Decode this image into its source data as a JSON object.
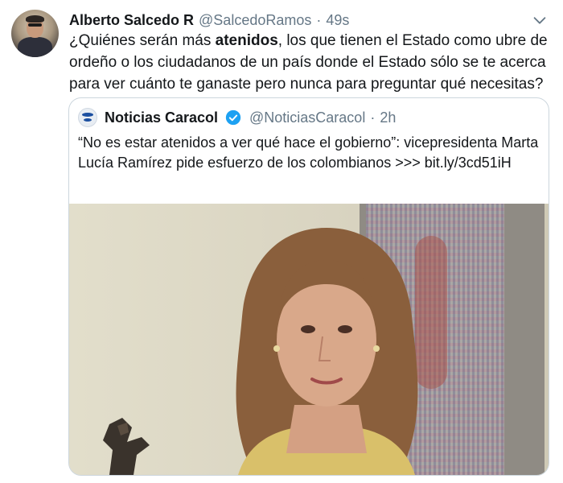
{
  "tweet": {
    "author_name": "Alberto Salcedo R",
    "author_handle": "@SalcedoRamos",
    "separator": "·",
    "time": "49s",
    "text_before": "¿Quiénes serán más ",
    "text_bold": "atenidos",
    "text_after": ", los que tienen el Estado como ubre de ordeño o los ciudadanos de un país donde el Estado sólo se te acerca para ver cuánto te ganaste pero nunca para preguntar qué necesitas?"
  },
  "quoted": {
    "name": "Noticias Caracol",
    "handle": "@NoticiasCaracol",
    "separator": "·",
    "time": "2h",
    "text": "“No es estar atenidos a ver qué hace el gobierno”: vicepresidenta Marta Lucía Ramírez pide esfuerzo de los colombianos  >>> bit.ly/3cd51iH"
  },
  "icons": {
    "avatar": "avatar-photo",
    "menu": "chevron-down-icon",
    "verified": "verified-badge-icon",
    "quoted_logo": "noticias-caracol-logo"
  },
  "colors": {
    "text": "#14171a",
    "secondary": "#657786",
    "verified": "#1da1f2",
    "border": "#ccd6dd"
  }
}
